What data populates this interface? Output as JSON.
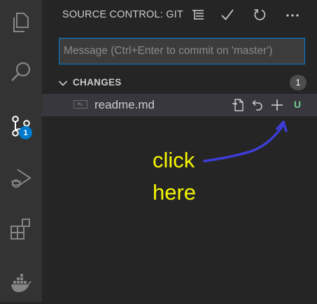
{
  "activity_bar": {
    "items": [
      "explorer-icon",
      "search-icon",
      "source-control-icon",
      "run-debug-icon",
      "extensions-icon",
      "docker-icon"
    ],
    "scm_badge": "1",
    "badge_color": "#007acc"
  },
  "sidebar": {
    "title": "SOURCE CONTROL: GIT",
    "toolbar": [
      "view-as-tree-icon",
      "commit-check-icon",
      "refresh-icon",
      "more-actions-icon"
    ]
  },
  "commit_message": {
    "placeholder": "Message (Ctrl+Enter to commit on 'master')",
    "value": ""
  },
  "changes": {
    "label": "CHANGES",
    "count": "1",
    "files": [
      {
        "icon_text": "M↓",
        "name": "readme.md",
        "status": "U",
        "actions": [
          "open-file-icon",
          "discard-changes-icon",
          "stage-changes-icon"
        ]
      }
    ]
  },
  "annotation": {
    "line1": "click",
    "line2": "here",
    "text_color": "#f5f500",
    "arrow_color": "#3d3dd6"
  },
  "colors": {
    "accent": "#007acc",
    "untracked": "#73c991"
  }
}
